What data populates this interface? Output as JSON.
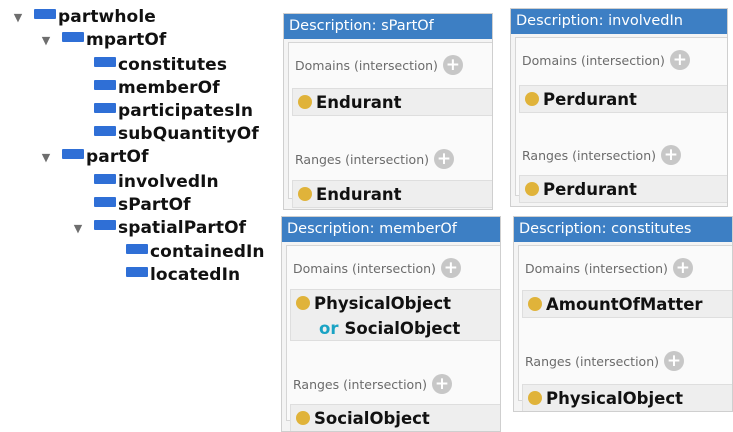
{
  "tree": {
    "partwhole": "partwhole",
    "mpartOf": "mpartOf",
    "constitutes": "constitutes",
    "memberOf": "memberOf",
    "participatesIn": "participatesIn",
    "subQuantityOf": "subQuantityOf",
    "partOf": "partOf",
    "involvedIn": "involvedIn",
    "sPartOf": "sPartOf",
    "spatialPartOf": "spatialPartOf",
    "containedIn": "containedIn",
    "locatedIn": "locatedIn",
    "expand_glyph": "▼"
  },
  "panels": {
    "spartof": {
      "title": "Description: sPartOf",
      "domains_label": "Domains (intersection)",
      "domain": "Endurant",
      "ranges_label": "Ranges (intersection)",
      "range": "Endurant"
    },
    "involvedin": {
      "title": "Description: involvedIn",
      "domains_label": "Domains (intersection)",
      "domain": "Perdurant",
      "ranges_label": "Ranges (intersection)",
      "range": "Perdurant"
    },
    "memberof": {
      "title": "Description: memberOf",
      "domains_label": "Domains (intersection)",
      "domain": "PhysicalObject",
      "domain_or_keyword": "or",
      "domain_or_class": "SocialObject",
      "ranges_label": "Ranges (intersection)",
      "range": "SocialObject"
    },
    "constitutes": {
      "title": "Description: constitutes",
      "domains_label": "Domains (intersection)",
      "domain": "AmountOfMatter",
      "ranges_label": "Ranges (intersection)",
      "range": "PhysicalObject"
    }
  },
  "plus_glyph": "+",
  "colors": {
    "property_bar": "#2f6fd6",
    "panel_header": "#3d7fc4",
    "class_dot": "#e0b33a",
    "or_keyword": "#1aa3c4"
  }
}
